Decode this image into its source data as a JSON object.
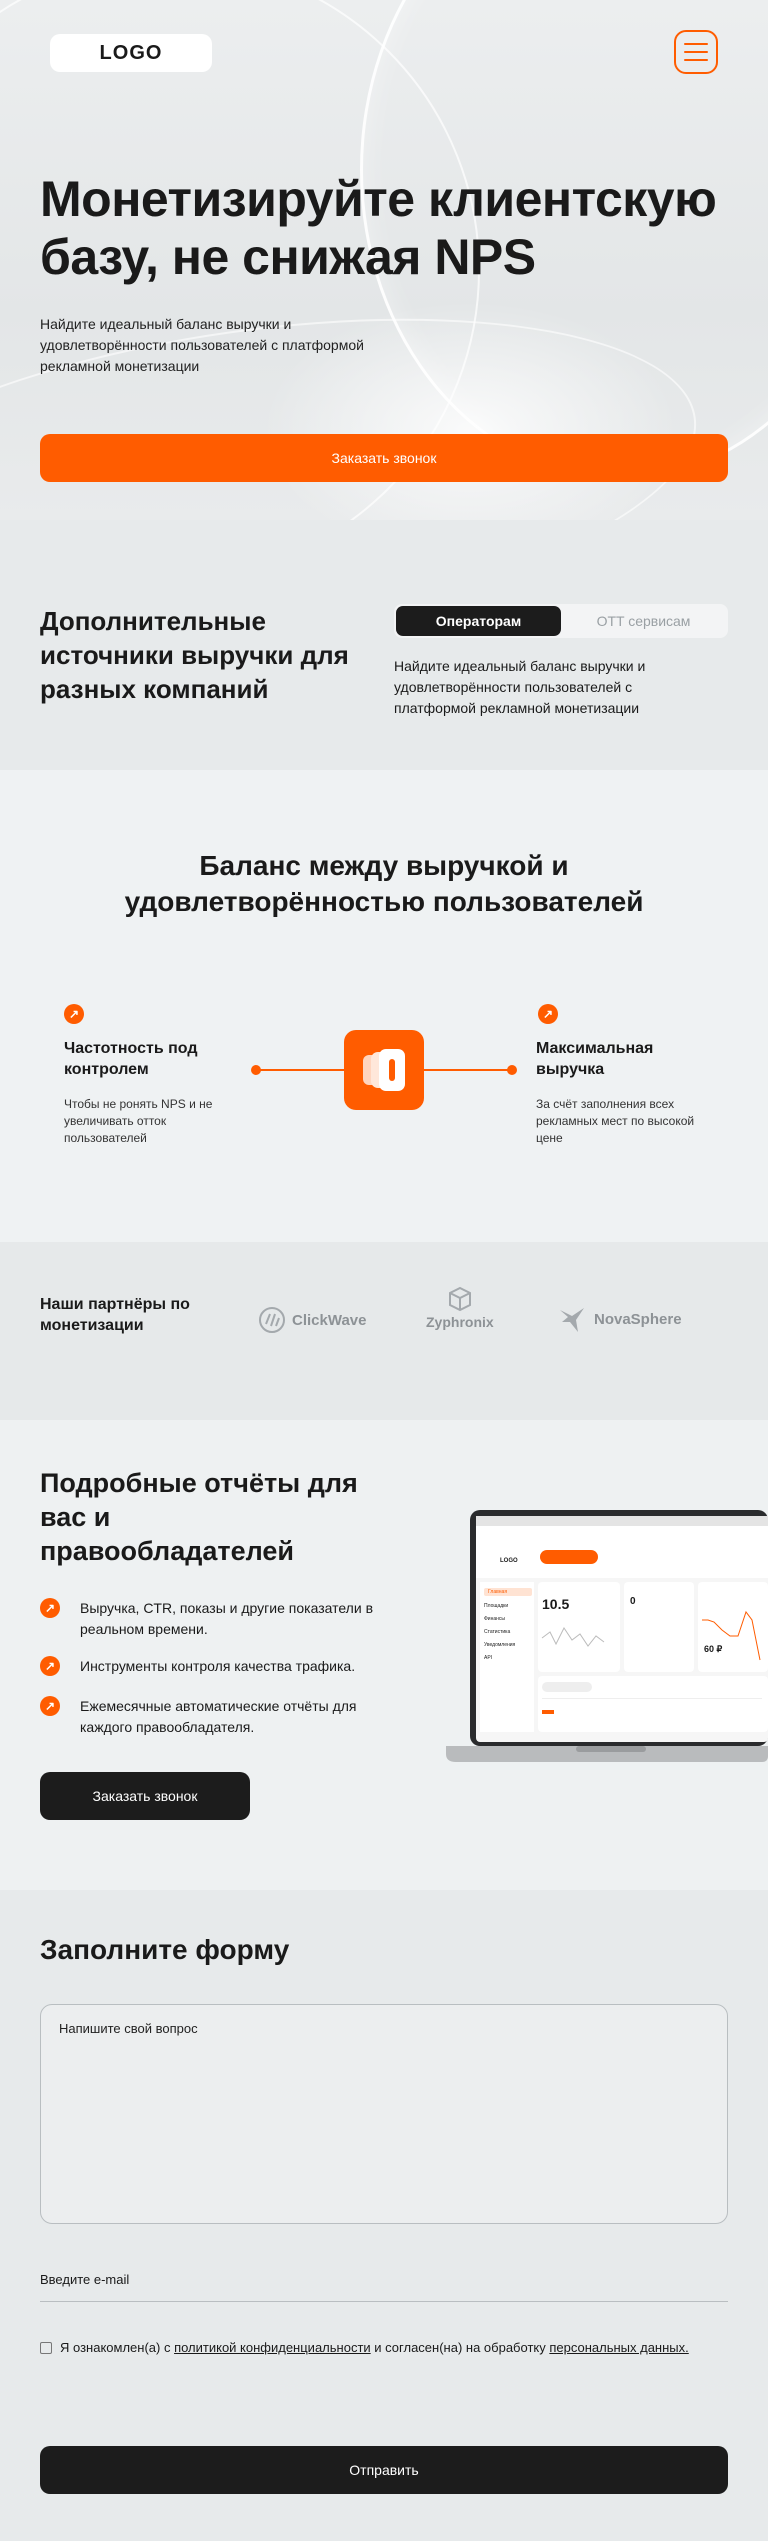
{
  "header": {
    "logo": "LOGO",
    "menu_icon": "menu-icon"
  },
  "hero": {
    "title": "Монетизируйте клиентскую базу, не снижая NPS",
    "subtitle": "Найдите идеальный баланс выручки и удовлетворённости пользователей с платформой рекламной монетизации",
    "cta": "Заказать звонок"
  },
  "sources": {
    "title": "Дополнительные источники выручки для разных компаний",
    "tabs": [
      {
        "label": "Операторам",
        "active": true
      },
      {
        "label": "OTT сервисам",
        "active": false
      }
    ],
    "text": "Найдите идеальный баланс выручки и удовлетворённости пользователей с платформой рекламной монетизации"
  },
  "balance": {
    "title": "Баланс между выручкой и удовлетворённостью пользователей",
    "left": {
      "title": "Частотность под контролем",
      "text": "Чтобы не ронять NPS и не увеличивать отток пользователей"
    },
    "right": {
      "title": "Максимальная выручка",
      "text": "За счёт заполнения всех рекламных мест по высокой цене"
    }
  },
  "partners": {
    "title": "Наши партнёры по монетизации",
    "items": [
      "ClickWave",
      "Zyphronix",
      "NovaSphere"
    ]
  },
  "reports": {
    "title": "Подробные отчёты для вас и правообладателей",
    "items": [
      "Выручка, CTR, показы и другие показатели в реальном времени.",
      "Инструменты контроля качества трафика.",
      "Ежемесячные автоматические отчёты для каждого правообладателя."
    ],
    "cta": "Заказать звонок",
    "screen": {
      "logo": "LOGO",
      "nav": [
        "Главная",
        "Площадки",
        "Финансы",
        "Статистика",
        "Уведомления",
        "API"
      ],
      "stat1": "10.5",
      "stat2": "0",
      "stat3": "60 ₽"
    }
  },
  "form": {
    "title": "Заполните форму",
    "question_placeholder": "Напишите свой вопрос",
    "email_placeholder": "Введите e-mail",
    "consent_prefix": "Я ознакомлен(а) с ",
    "consent_link1": "политикой конфиденциальности",
    "consent_middle": " и согласен(на) на обработку ",
    "consent_link2": "персональных данных.",
    "submit": "Отправить"
  },
  "colors": {
    "accent": "#ff5c00",
    "dark": "#1c1c1c"
  }
}
